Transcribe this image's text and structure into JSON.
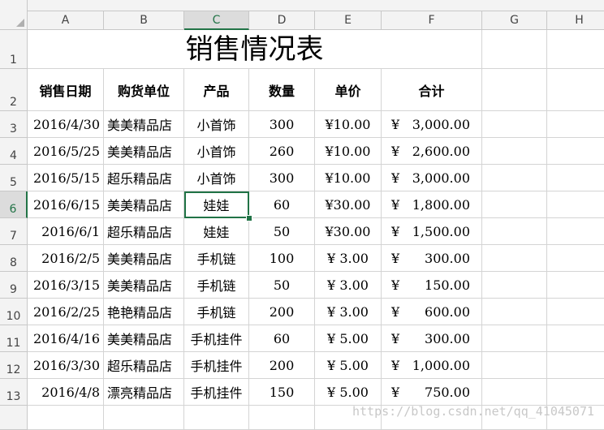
{
  "columns": [
    "A",
    "B",
    "C",
    "D",
    "E",
    "F",
    "G",
    "H"
  ],
  "rows": [
    "1",
    "2",
    "3",
    "4",
    "5",
    "6",
    "7",
    "8",
    "9",
    "10",
    "11",
    "12",
    "13",
    ""
  ],
  "active_cell": "C6",
  "title": "销售情况表",
  "headers": [
    "销售日期",
    "购货单位",
    "产品",
    "数量",
    "单价",
    "合计"
  ],
  "records": [
    {
      "date": "2016/4/30",
      "unit": "美美精品店",
      "product": "小首饰",
      "qty": "300",
      "price": "¥10.00",
      "total_sym": "¥",
      "total": "3,000.00"
    },
    {
      "date": "2016/5/25",
      "unit": "美美精品店",
      "product": "小首饰",
      "qty": "260",
      "price": "¥10.00",
      "total_sym": "¥",
      "total": "2,600.00"
    },
    {
      "date": "2016/5/15",
      "unit": "超乐精品店",
      "product": "小首饰",
      "qty": "300",
      "price": "¥10.00",
      "total_sym": "¥",
      "total": "3,000.00"
    },
    {
      "date": "2016/6/15",
      "unit": "美美精品店",
      "product": "娃娃",
      "qty": "60",
      "price": "¥30.00",
      "total_sym": "¥",
      "total": "1,800.00"
    },
    {
      "date": "2016/6/1",
      "unit": "超乐精品店",
      "product": "娃娃",
      "qty": "50",
      "price": "¥30.00",
      "total_sym": "¥",
      "total": "1,500.00"
    },
    {
      "date": "2016/2/5",
      "unit": "美美精品店",
      "product": "手机链",
      "qty": "100",
      "price": "¥ 3.00",
      "total_sym": "¥",
      "total": "300.00"
    },
    {
      "date": "2016/3/15",
      "unit": "美美精品店",
      "product": "手机链",
      "qty": "50",
      "price": "¥ 3.00",
      "total_sym": "¥",
      "total": "150.00"
    },
    {
      "date": "2016/2/25",
      "unit": "艳艳精品店",
      "product": "手机链",
      "qty": "200",
      "price": "¥ 3.00",
      "total_sym": "¥",
      "total": "600.00"
    },
    {
      "date": "2016/4/16",
      "unit": "美美精品店",
      "product": "手机挂件",
      "qty": "60",
      "price": "¥ 5.00",
      "total_sym": "¥",
      "total": "300.00"
    },
    {
      "date": "2016/3/30",
      "unit": "超乐精品店",
      "product": "手机挂件",
      "qty": "200",
      "price": "¥ 5.00",
      "total_sym": "¥",
      "total": "1,000.00"
    },
    {
      "date": "2016/4/8",
      "unit": "漂亮精品店",
      "product": "手机挂件",
      "qty": "150",
      "price": "¥ 5.00",
      "total_sym": "¥",
      "total": "750.00"
    }
  ],
  "watermark": "https://blog.csdn.net/qq_41045071"
}
